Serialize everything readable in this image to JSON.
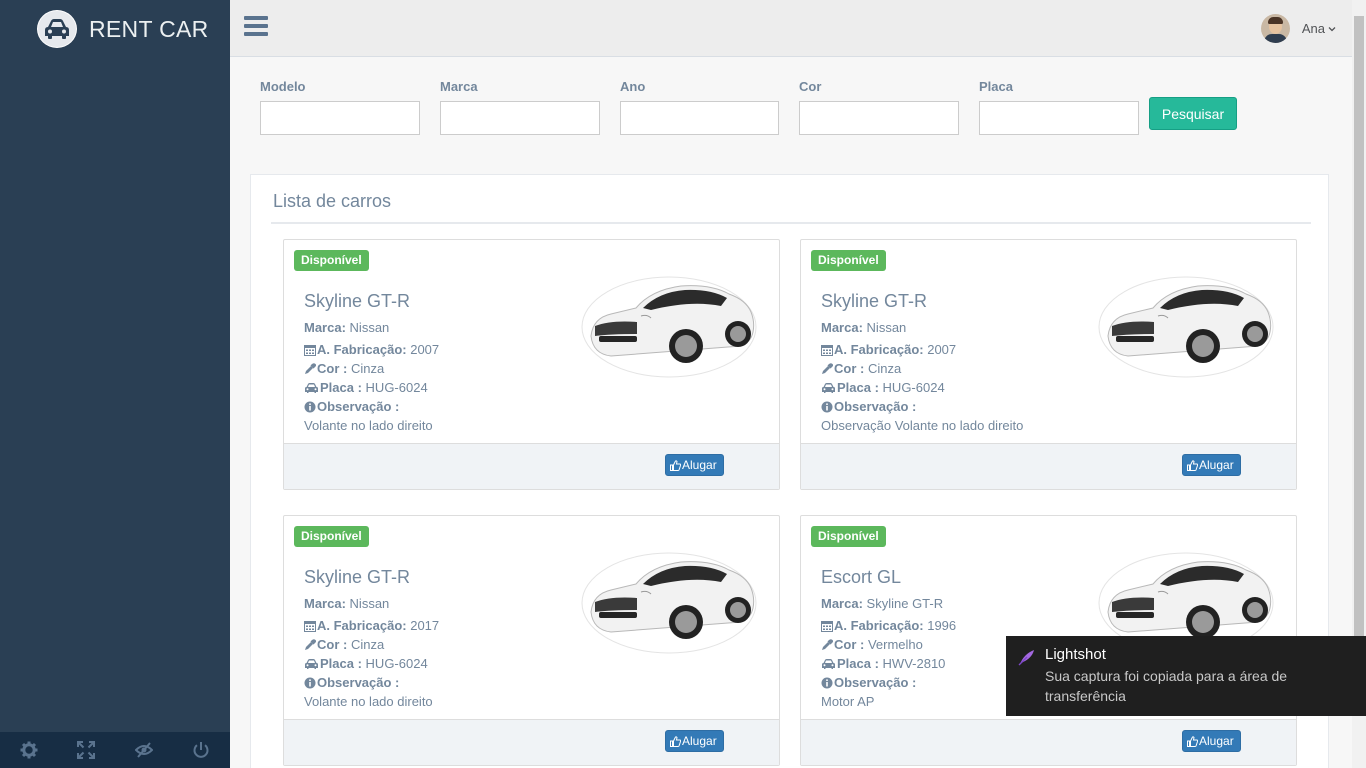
{
  "app": {
    "brand_title": "RENT CAR"
  },
  "user": {
    "name": "Ana"
  },
  "search": {
    "fields": [
      {
        "label": "Modelo",
        "value": ""
      },
      {
        "label": "Marca",
        "value": ""
      },
      {
        "label": "Ano",
        "value": ""
      },
      {
        "label": "Cor",
        "value": ""
      },
      {
        "label": "Placa",
        "value": ""
      }
    ],
    "button_label": "Pesquisar"
  },
  "list": {
    "title": "Lista de carros",
    "cars": [
      {
        "status": "Disponível",
        "model": "Skyline GT-R",
        "brand_label": "Marca:",
        "brand": "Nissan",
        "year_label": "A. Fabricação:",
        "year": "2007",
        "color_label": "Cor :",
        "color": "Cinza",
        "plate_label": "Placa :",
        "plate": "HUG-6024",
        "notes_label": "Observação :",
        "notes": "Volante no lado direito",
        "rent_label": "Alugar"
      },
      {
        "status": "Disponível",
        "model": "Skyline GT-R",
        "brand_label": "Marca:",
        "brand": "Nissan",
        "year_label": "A. Fabricação:",
        "year": "2007",
        "color_label": "Cor :",
        "color": "Cinza",
        "plate_label": "Placa :",
        "plate": "HUG-6024",
        "notes_label": "Observação :",
        "notes": "Observação Volante no lado direito",
        "rent_label": "Alugar"
      },
      {
        "status": "Disponível",
        "model": "Skyline GT-R",
        "brand_label": "Marca:",
        "brand": "Nissan",
        "year_label": "A. Fabricação:",
        "year": "2017",
        "color_label": "Cor :",
        "color": "Cinza",
        "plate_label": "Placa :",
        "plate": "HUG-6024",
        "notes_label": "Observação :",
        "notes": "Volante no lado direito",
        "rent_label": "Alugar"
      },
      {
        "status": "Disponível",
        "model": "Escort GL",
        "brand_label": "Marca:",
        "brand": "Skyline GT-R",
        "year_label": "A. Fabricação:",
        "year": "1996",
        "color_label": "Cor :",
        "color": "Vermelho",
        "plate_label": "Placa :",
        "plate": "HWV-2810",
        "notes_label": "Observação :",
        "notes": "Motor AP",
        "rent_label": "Alugar"
      }
    ]
  },
  "toast": {
    "title": "Lightshot",
    "message": "Sua captura foi copiada para a área de transferência"
  },
  "colors": {
    "sidebar": "#2A3F54",
    "accent_green": "#26B99A",
    "badge_green": "#5CB85C",
    "button_blue": "#337AB7"
  },
  "icons": {
    "brand": "car-icon",
    "footer": [
      "gear-icon",
      "fullscreen-icon",
      "eye-slash-icon",
      "power-icon"
    ],
    "menu": "hamburger-icon",
    "year": "calendar-icon",
    "color": "eyedropper-icon",
    "plate": "car-icon",
    "notes": "info-circle-icon",
    "rent": "thumbs-up-icon",
    "toast": "feather-icon"
  }
}
